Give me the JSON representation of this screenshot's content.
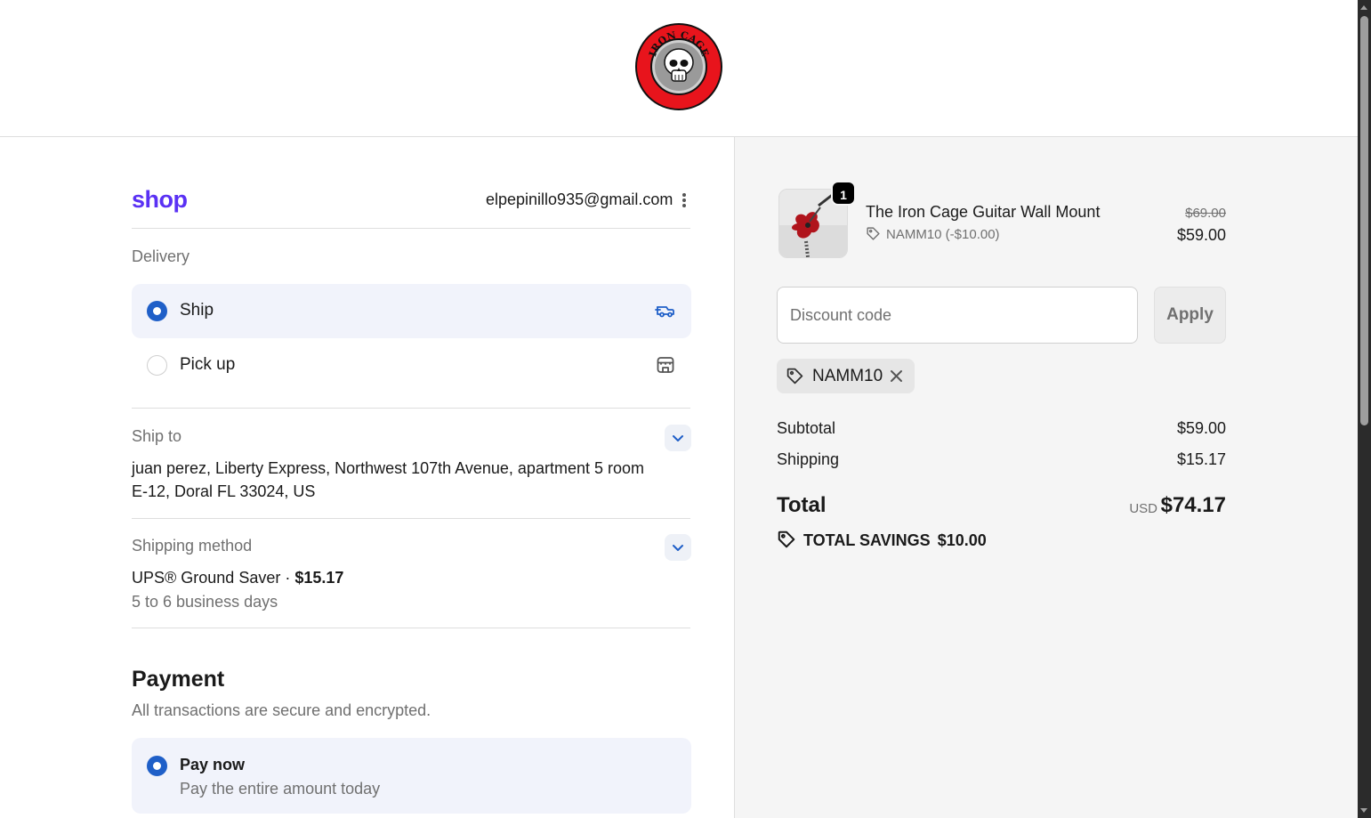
{
  "header": {
    "logo_text": "IRON CAGE",
    "logo_name": "iron-cage-skull-logo"
  },
  "account": {
    "shop_logo": "shop",
    "email": "elpepinillo935@gmail.com"
  },
  "delivery": {
    "title": "Delivery",
    "options": [
      {
        "label": "Ship",
        "selected": true,
        "icon": "delivery-truck-icon"
      },
      {
        "label": "Pick up",
        "selected": false,
        "icon": "store-icon"
      }
    ]
  },
  "ship_to": {
    "title": "Ship to",
    "address": "juan perez, Liberty Express, Northwest 107th Avenue, apartment 5 room E-12, Doral FL 33024, US"
  },
  "shipping_method": {
    "title": "Shipping method",
    "name": "UPS® Ground Saver",
    "separator": "·",
    "price": "$15.17",
    "eta": "5 to 6 business days"
  },
  "payment": {
    "title": "Payment",
    "subtitle": "All transactions are secure and encrypted.",
    "option_title": "Pay now",
    "option_sub": "Pay the entire amount today"
  },
  "summary": {
    "product": {
      "name": "The Iron Cage Guitar Wall Mount",
      "quantity": "1",
      "discount": "NAMM10 (-$10.00)",
      "price_original": "$69.00",
      "price_final": "$59.00"
    },
    "discount_placeholder": "Discount code",
    "apply_label": "Apply",
    "applied_code": "NAMM10",
    "subtotal_label": "Subtotal",
    "subtotal_value": "$59.00",
    "shipping_label": "Shipping",
    "shipping_value": "$15.17",
    "total_label": "Total",
    "currency": "USD",
    "total_value": "$74.17",
    "savings_label": "TOTAL SAVINGS",
    "savings_value": "$10.00"
  },
  "colors": {
    "accent": "#1f5fc8",
    "shop_purple": "#5a31f4",
    "logo_red": "#e8141c"
  }
}
